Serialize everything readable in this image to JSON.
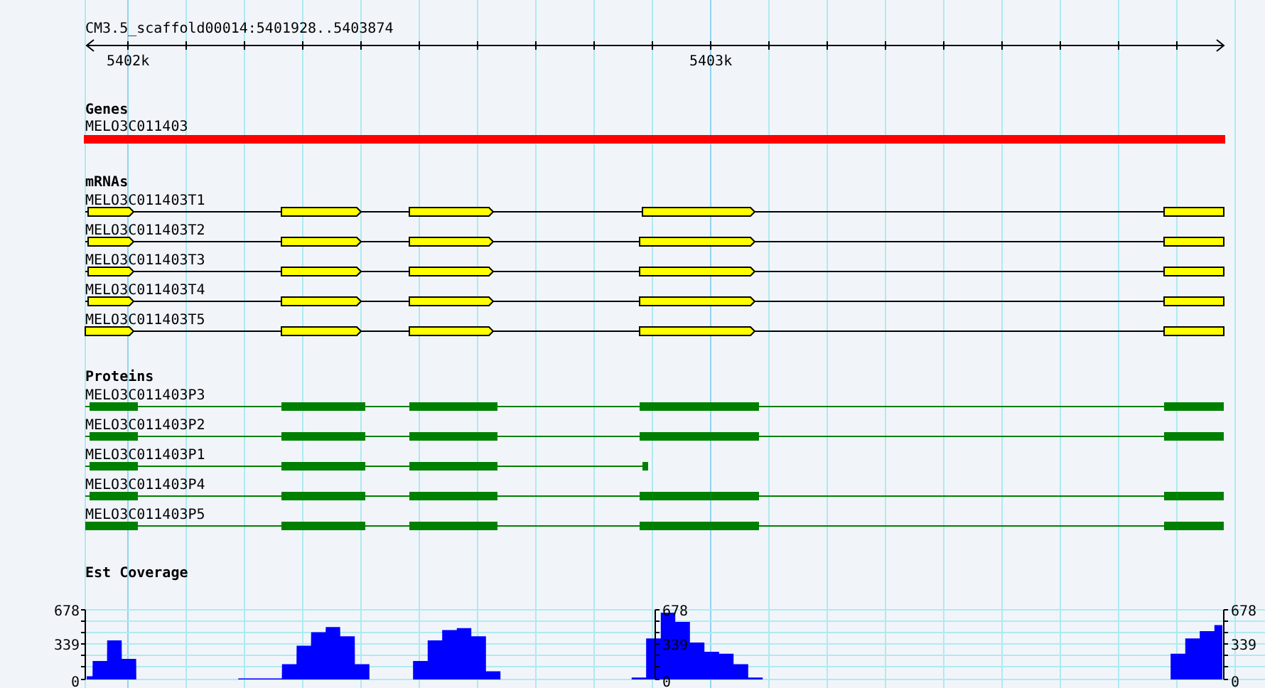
{
  "ruler": {
    "title": "CM3.5_scaffold00014:5401928..5403874",
    "tick_labels": [
      "5402k",
      "5403k"
    ]
  },
  "genes": {
    "title": "Genes",
    "features": [
      {
        "name": "MELO3C011403"
      }
    ]
  },
  "mrnas": {
    "title": "mRNAs",
    "features": [
      {
        "name": "MELO3C011403T1"
      },
      {
        "name": "MELO3C011403T2"
      },
      {
        "name": "MELO3C011403T3"
      },
      {
        "name": "MELO3C011403T4"
      },
      {
        "name": "MELO3C011403T5"
      }
    ]
  },
  "proteins": {
    "title": "Proteins",
    "features": [
      {
        "name": "MELO3C011403P3"
      },
      {
        "name": "MELO3C011403P2"
      },
      {
        "name": "MELO3C011403P1"
      },
      {
        "name": "MELO3C011403P4"
      },
      {
        "name": "MELO3C011403P5"
      }
    ]
  },
  "coverage": {
    "title": "Est Coverage",
    "axis_labels": [
      {
        "labels": [
          "678",
          "339",
          "0"
        ]
      },
      {
        "labels": [
          "678",
          "339",
          "0"
        ]
      },
      {
        "labels": [
          "678",
          "339",
          "0"
        ]
      }
    ]
  }
}
